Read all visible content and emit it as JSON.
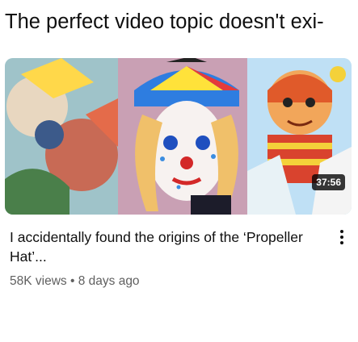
{
  "banner": {
    "text": "The perfect video topic doesn't exi-"
  },
  "video": {
    "duration": "37:56",
    "title": "I accidentally found the origins of the ‘Propeller Hat’...",
    "views": "58K views",
    "separator": "•",
    "age": "8 days ago"
  },
  "actions": {
    "menu_icon": "more-vert-icon"
  }
}
